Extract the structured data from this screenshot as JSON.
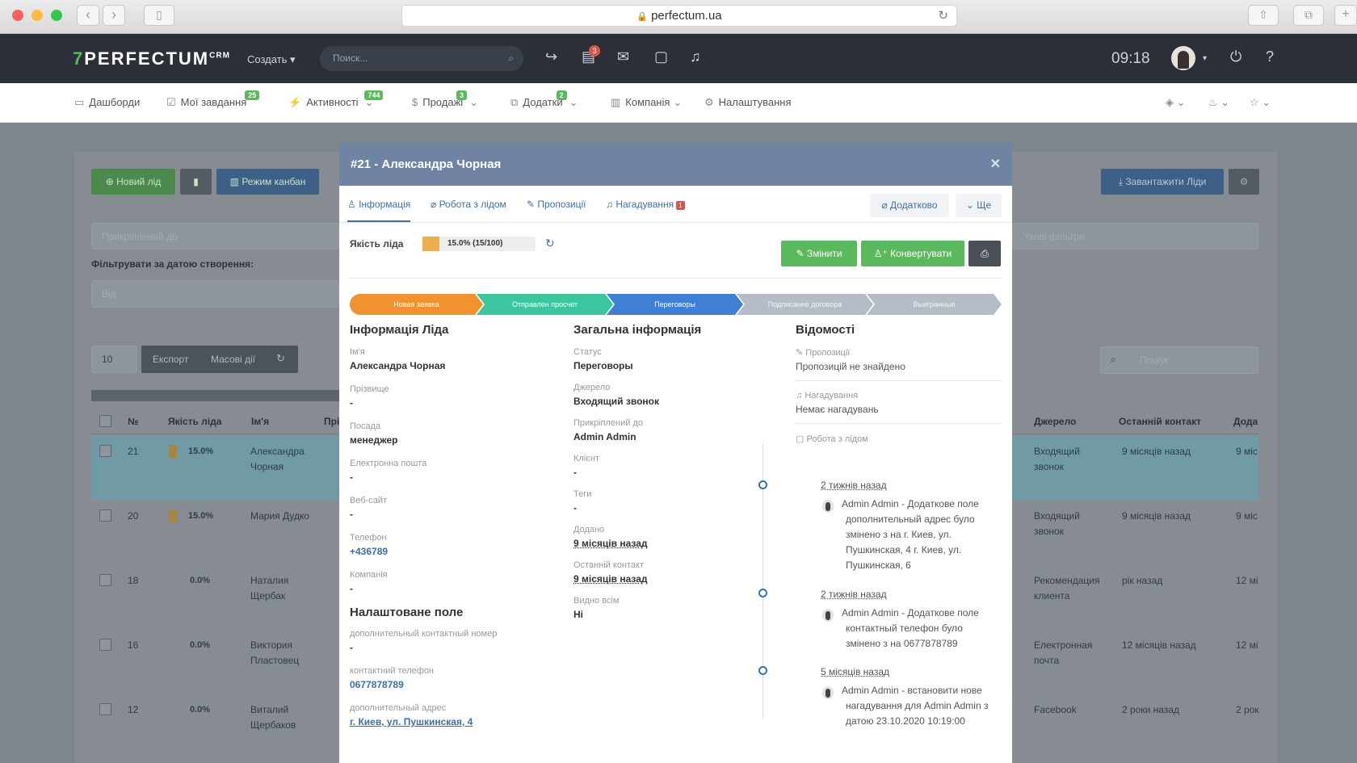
{
  "browser": {
    "url": "perfectum.ua"
  },
  "top": {
    "logo": "PERFECTUM",
    "logo_sup": "CRM",
    "create": "Создать ▾",
    "search_placeholder": "Поиск...",
    "notif_count": "3",
    "time": "09:18"
  },
  "subnav": [
    {
      "label": "Дашборди",
      "badge": ""
    },
    {
      "label": "Мої завдання",
      "badge": "25"
    },
    {
      "label": "Активності",
      "badge": "744"
    },
    {
      "label": "Продажі",
      "badge": "3"
    },
    {
      "label": "Додатки",
      "badge": "2"
    },
    {
      "label": "Компанія",
      "badge": ""
    },
    {
      "label": "Налаштування",
      "badge": ""
    }
  ],
  "background": {
    "new_lead": "Новий лід",
    "kanban": "Режим канбан",
    "download": "Завантажити Ліди",
    "attached_to": "Прикріплений до",
    "more_filters": "ткові фільтри",
    "filter_date": "Фільтрувати за датою створення:",
    "from": "Від",
    "page_size": "10",
    "export": "Експорт",
    "bulk": "Масові дії",
    "search": "Пошук",
    "headers": {
      "num": "№",
      "quality": "Якість ліда",
      "name": "Ім'я",
      "pri": "Прі",
      "source": "Джерело",
      "last": "Останній контакт",
      "added": "Дода"
    },
    "rows": [
      {
        "num": "21",
        "q": "15.0%",
        "name": "Александра Чорная",
        "source": "Входящий звонок",
        "last": "9 місяців назад",
        "added": "9 міс"
      },
      {
        "num": "20",
        "q": "15.0%",
        "name": "Мария Дудко",
        "source": "Входящий звонок",
        "last": "9 місяців назад",
        "added": "9 міс"
      },
      {
        "num": "18",
        "q": "0.0%",
        "name": "Наталия Щербак",
        "source": "Рекомендация клиента",
        "last": "рік назад",
        "added": "12 мі"
      },
      {
        "num": "16",
        "q": "0.0%",
        "name": "Виктория Пластовец",
        "source": "Електронная почта",
        "last": "12 місяців назад",
        "added": "12 мі"
      },
      {
        "num": "12",
        "q": "0.0%",
        "name": "Виталий Щербаков",
        "source": "Facebook",
        "last": "2 роки назад",
        "added": "2 рок"
      }
    ]
  },
  "modal": {
    "title": "#21 - Александра Чорная",
    "tabs": [
      "Інформація",
      "Робота з лідом",
      "Пропозиції",
      "Нагадування"
    ],
    "reminder_badge": "1",
    "extra": "Додатково",
    "more": "Ще",
    "quality_label": "Якість ліда",
    "quality_value": "15.0% (15/100)",
    "quality_fraction": 0.15,
    "edit": "Змінити",
    "convert": "Конвертувати",
    "stages": [
      {
        "label": "Новая заявка",
        "color": "#f0922e"
      },
      {
        "label": "Отправлен просчет",
        "color": "#3cc6a0"
      },
      {
        "label": "Переговоры",
        "color": "#3f7fd4"
      },
      {
        "label": "Подписание договора",
        "color": "#b5bcc6"
      },
      {
        "label": "Выигранные",
        "color": "#b5bcc6"
      }
    ],
    "lead_info": {
      "heading": "Інформація Ліда",
      "fields": [
        {
          "label": "Ім'я",
          "value": "Александра Чорная"
        },
        {
          "label": "Прізвище",
          "value": "-"
        },
        {
          "label": "Посада",
          "value": "менеджер"
        },
        {
          "label": "Електронна пошта",
          "value": "-"
        },
        {
          "label": "Веб-сайт",
          "value": "-"
        },
        {
          "label": "Телефон",
          "value": "+436789"
        },
        {
          "label": "Компанія",
          "value": "-"
        }
      ],
      "custom_heading": "Налаштоване поле",
      "custom": [
        {
          "label": "дополнительный контактный номер",
          "value": "-"
        },
        {
          "label": "контактний телефон",
          "value": "0677878789"
        },
        {
          "label": "дополнительный адрес",
          "value": "г. Киев, ул. Пушкинская, 4"
        }
      ]
    },
    "general": {
      "heading": "Загальна інформація",
      "fields": [
        {
          "label": "Статус",
          "value": "Переговоры"
        },
        {
          "label": "Джерело",
          "value": "Входящий звонок"
        },
        {
          "label": "Прикріплений до",
          "value": "Admin Admin"
        },
        {
          "label": "Клієнт",
          "value": "-"
        },
        {
          "label": "Теги",
          "value": "-"
        },
        {
          "label": "Додано",
          "value": "9 місяців назад"
        },
        {
          "label": "Останній контакт",
          "value": "9 місяців назад"
        },
        {
          "label": "Видно всім",
          "value": "Ні"
        }
      ]
    },
    "details": {
      "heading": "Відомості",
      "proposals_label": "Пропозиції",
      "proposals_value": "Пропозицій не знайдено",
      "reminders_label": "Нагадування",
      "reminders_value": "Немає нагадувань",
      "work_label": "Робота з лідом",
      "timeline": [
        {
          "date": "2 тижнів назад",
          "text": [
            "Admin Admin - Додаткове поле",
            "дополнительный адрес було",
            "змінено з на г. Киев, ул.",
            "Пушкинская, 4 г. Киев, ул.",
            "Пушкинская, 6"
          ]
        },
        {
          "date": "2 тижнів назад",
          "text": [
            "Admin Admin - Додаткове поле",
            "контактный телефон було",
            "змінено з на 0677878789"
          ]
        },
        {
          "date": "5 місяців назад",
          "text": [
            "Admin Admin - встановити нове",
            "нагадування для Admin Admin з",
            "датою 23.10.2020 10:19:00"
          ]
        }
      ]
    }
  }
}
